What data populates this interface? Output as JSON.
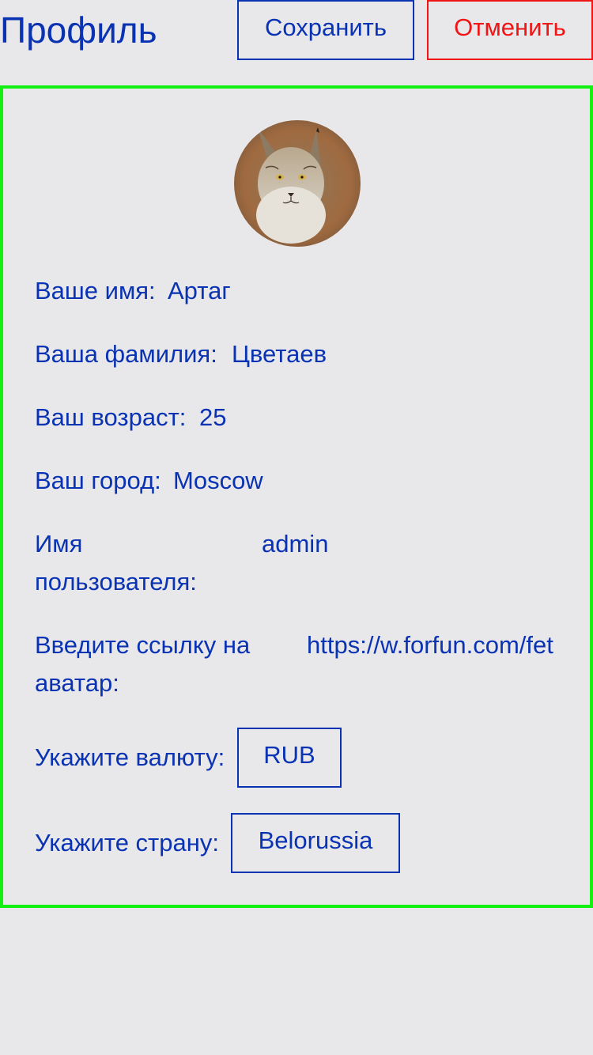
{
  "header": {
    "title": "Профиль",
    "save_label": "Сохранить",
    "cancel_label": "Отменить"
  },
  "profile": {
    "avatar_icon": "lynx-avatar-photo",
    "name_label": "Ваше имя:",
    "name_value": "Артаг",
    "surname_label": "Ваша фамилия:",
    "surname_value": "Цветаев",
    "age_label": "Ваш возраст:",
    "age_value": "25",
    "city_label": "Ваш город:",
    "city_value": "Moscow",
    "username_label": "Имя пользователя:",
    "username_value": "admin",
    "avatar_link_label": "Введите ссылку на аватар:",
    "avatar_link_value": "https://w.forfun.com/fet",
    "currency_label": "Укажите валюту:",
    "currency_value": "RUB",
    "country_label": "Укажите страну:",
    "country_value": "Belorussia"
  },
  "colors": {
    "background": "#e8e7ea",
    "text": "#0a33b3",
    "cancel": "#f01414",
    "card_border": "#14f014"
  }
}
